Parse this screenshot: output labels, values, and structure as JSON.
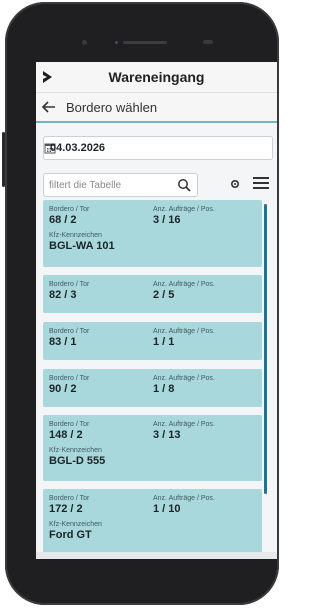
{
  "app": {
    "title": "Wareneingang"
  },
  "subheader": {
    "title": "Bordero wählen"
  },
  "date": {
    "value": "04.03.2026"
  },
  "filter": {
    "placeholder": "filtert die Tabelle"
  },
  "labels": {
    "bordero_tor": "Bordero / Tor",
    "auftraege_pos": "Anz. Aufträge / Pos.",
    "kfz": "Kfz-Kennzeichen"
  },
  "cards": [
    {
      "bordero": "68 / 2",
      "auftraege": "3 / 16",
      "kfz": "BGL-WA 101"
    },
    {
      "bordero": "82 / 3",
      "auftraege": "2 / 5",
      "kfz": ""
    },
    {
      "bordero": "83 / 1",
      "auftraege": "1 / 1",
      "kfz": ""
    },
    {
      "bordero": "90 / 2",
      "auftraege": "1 / 8",
      "kfz": ""
    },
    {
      "bordero": "148 / 2",
      "auftraege": "3 / 13",
      "kfz": "BGL-D 555"
    },
    {
      "bordero": "172 / 2",
      "auftraege": "1 / 10",
      "kfz": "Ford GT"
    }
  ],
  "icons": {
    "menu": "chevron-right-icon",
    "back": "arrow-left-icon",
    "calendar": "calendar-icon",
    "search": "search-icon",
    "settings": "settings-icon",
    "list": "list-icon"
  },
  "colors": {
    "card": "#a9d8dc",
    "accent": "#6fb5c0",
    "scrollbar": "#2b6d8f"
  }
}
